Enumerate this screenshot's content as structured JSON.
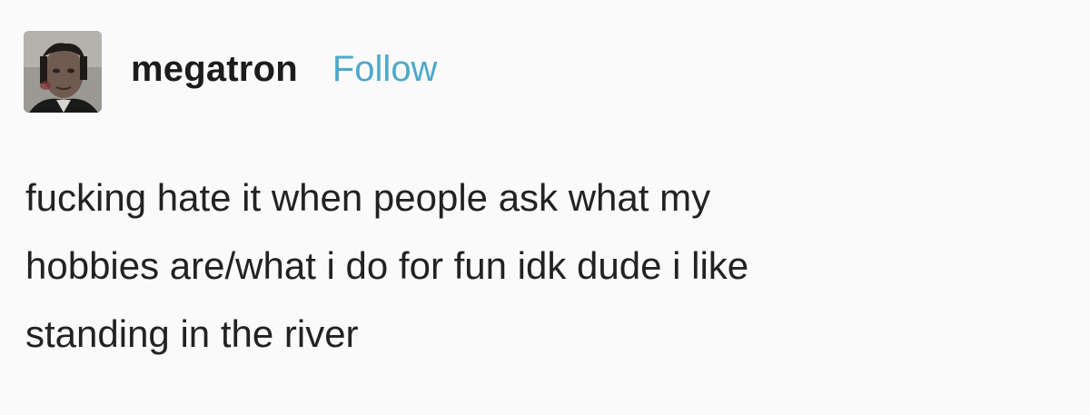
{
  "post": {
    "username": "megatron",
    "follow_label": "Follow",
    "avatar_icon": "user-avatar",
    "lines": [
      "fucking hate it when people ask what my",
      "hobbies are/what i do for fun idk dude i like",
      "standing in the river"
    ]
  },
  "colors": {
    "background": "#fafafa",
    "text": "#222222",
    "follow_link": "#4ea9c9"
  }
}
